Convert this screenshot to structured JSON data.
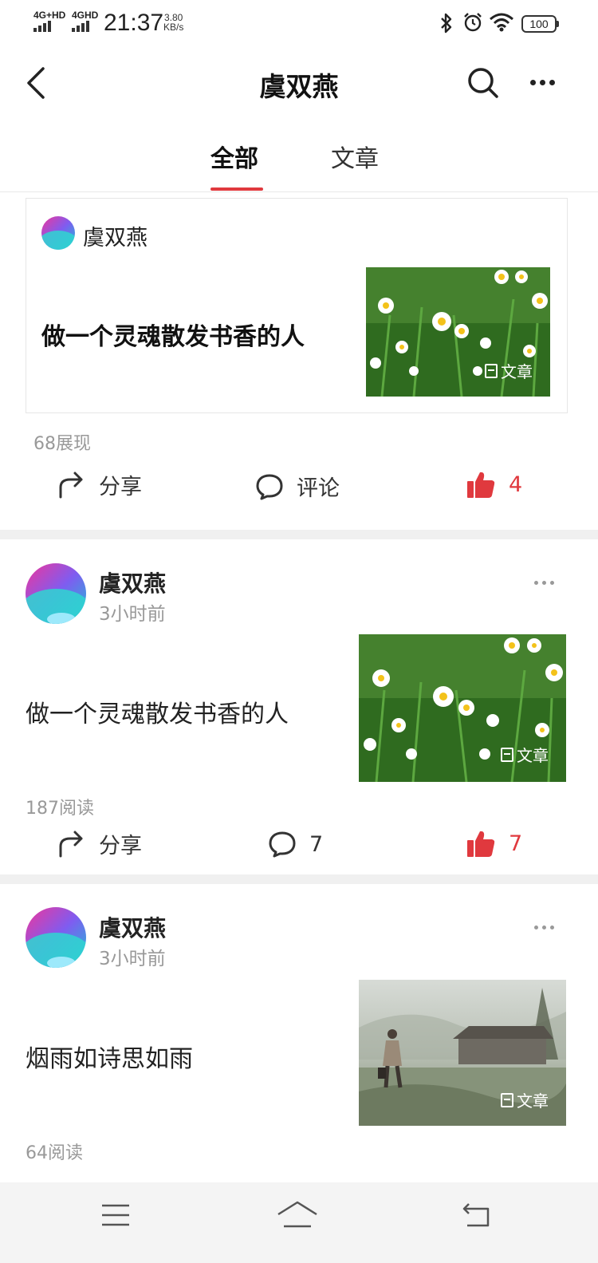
{
  "status_bar": {
    "network1": "4G+HD",
    "network2": "4GHD",
    "time": "21:37",
    "speed_value": "3.80",
    "speed_unit": "KB/s",
    "battery": "100"
  },
  "header": {
    "title": "虞双燕",
    "back_icon": "back-chevron-icon",
    "search_icon": "search-icon",
    "more_icon": "more-dots-icon"
  },
  "tabs": [
    {
      "label": "全部",
      "active": true
    },
    {
      "label": "文章",
      "active": false
    }
  ],
  "accent_color": "#e0393e",
  "feed": [
    {
      "author": "虞双燕",
      "title": "做一个灵魂散发书香的人",
      "badge": "文章",
      "stat": "68展现",
      "share_label": "分享",
      "comment_label": "评论",
      "likes": "4"
    },
    {
      "author": "虞双燕",
      "time": "3小时前",
      "title": "做一个灵魂散发书香的人",
      "badge": "文章",
      "stat": "187阅读",
      "share_label": "分享",
      "comments": "7",
      "likes": "7"
    },
    {
      "author": "虞双燕",
      "time": "3小时前",
      "title": "烟雨如诗思如雨",
      "badge": "文章",
      "stat": "64阅读"
    }
  ],
  "bottom_nav": {
    "menu_icon": "menu-lines-icon",
    "home_icon": "home-icon",
    "back_icon": "return-icon"
  }
}
